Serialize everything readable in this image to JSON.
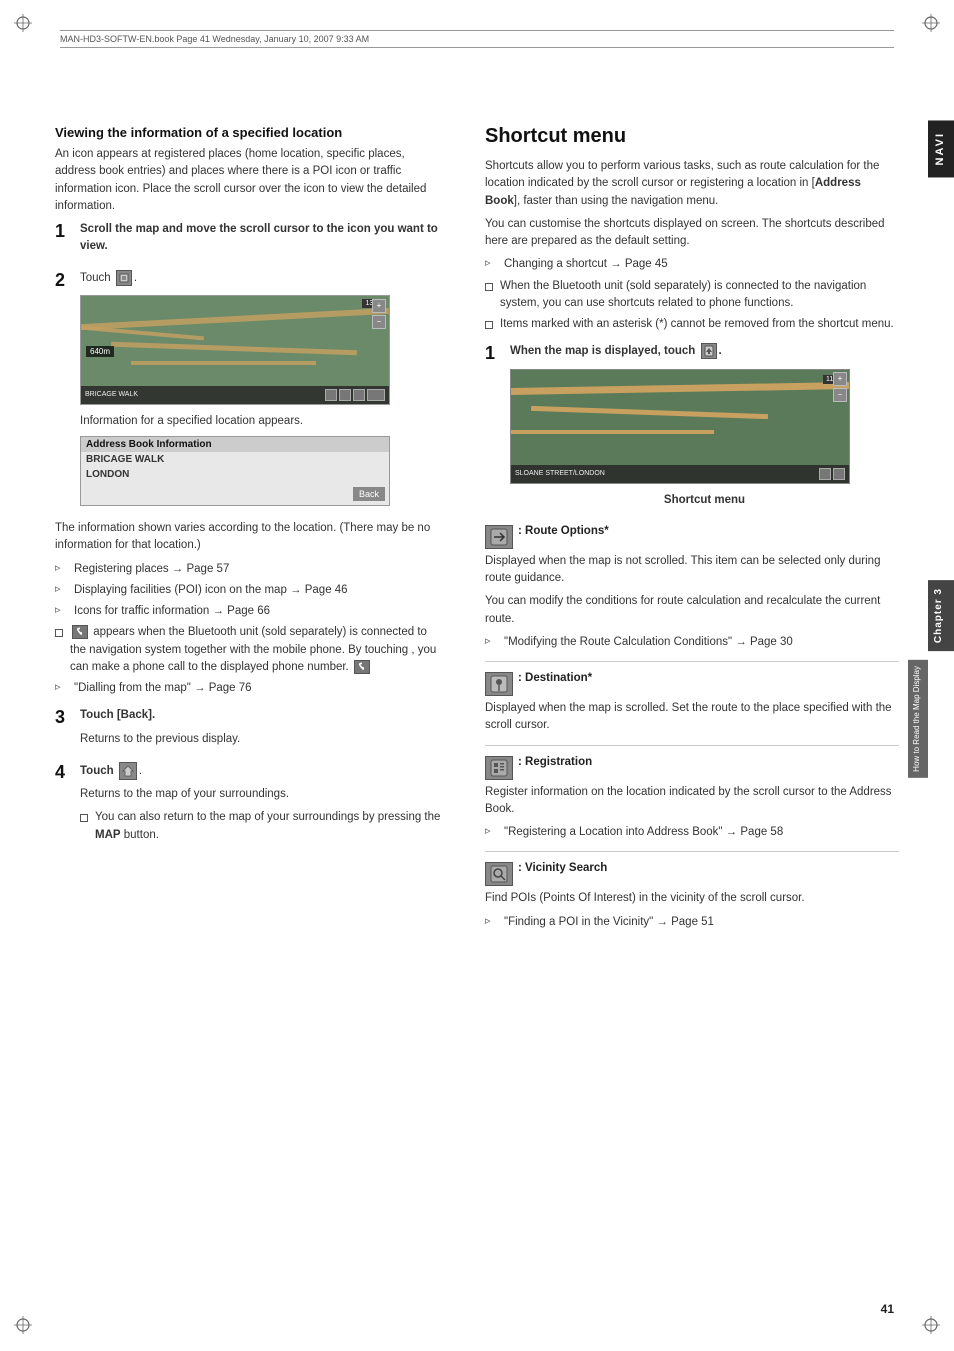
{
  "page": {
    "header": "MAN-HD3-SOFTW-EN.book  Page 41  Wednesday, January 10, 2007  9:33 AM",
    "page_number": "41",
    "navi_tab": "NAVI",
    "chapter_tab": "Chapter 3",
    "chapter_sub_tab": "How to Read the Map Display"
  },
  "left_section": {
    "heading": "Viewing the information of a specified location",
    "intro": "An icon appears at registered places (home location, specific places, address book entries) and places where there is a POI icon or traffic information icon. Place the scroll cursor over the icon to view the detailed information.",
    "step1": {
      "number": "1",
      "text": "Scroll the map and move the scroll cursor to the icon you want to view."
    },
    "step2": {
      "number": "2",
      "text": "Touch"
    },
    "map_caption": "Information for a specified location appears.",
    "map_info_title": "Address Book Information",
    "map_info_row1": "BRICAGE WALK",
    "map_info_row2": "LONDON",
    "info_body": "The information shown varies according to the location. (There may be no information for that location.)",
    "bullets": [
      {
        "type": "arrow",
        "text": "Registering places → Page 57"
      },
      {
        "type": "arrow",
        "text": "Displaying facilities (POI) icon on the map → Page 46"
      },
      {
        "type": "arrow",
        "text": "Icons for traffic information → Page 66"
      },
      {
        "type": "square",
        "text": "appears when the Bluetooth unit (sold separately) is connected to the navigation system together with the mobile phone. By touching , you can make a phone call to the displayed phone number."
      },
      {
        "type": "arrow",
        "text": "\"Dialling from the map\" → Page 76"
      }
    ],
    "step3": {
      "number": "3",
      "label": "Touch [Back].",
      "text": "Returns to the previous display."
    },
    "step4": {
      "number": "4",
      "label": "Touch",
      "text": "Returns to the map of your surroundings.",
      "sub_bullet": "You can also return to the map of your surroundings by pressing the MAP button."
    }
  },
  "right_section": {
    "title": "Shortcut menu",
    "intro1": "Shortcuts allow you to perform various tasks, such as route calculation for the location indicated by the scroll cursor or registering a location in [Address Book], faster than using the navigation menu.",
    "intro2": "You can customise the shortcuts displayed on screen. The shortcuts described here are prepared as the default setting.",
    "bullets": [
      {
        "type": "arrow",
        "text": "Changing a shortcut → Page 45"
      },
      {
        "type": "square",
        "text": "When the Bluetooth unit (sold separately) is connected to the navigation system, you can use shortcuts related to phone functions."
      },
      {
        "type": "square",
        "text": "Items marked with an asterisk (*) cannot be removed from the shortcut menu."
      }
    ],
    "step1": {
      "number": "1",
      "text": "When the map is displayed, touch"
    },
    "map_caption": "Shortcut menu",
    "icon_sections": [
      {
        "icon_label": ": Route Options*",
        "body": "Displayed when the map is not scrolled. This item can be selected only during route guidance.",
        "body2": "You can modify the conditions for route calculation and recalculate the current route.",
        "arrow_text": "\"Modifying the Route Calculation Conditions\" → Page 30"
      },
      {
        "icon_label": ": Destination*",
        "body": "Displayed when the map is scrolled. Set the route to the place specified with the scroll cursor."
      },
      {
        "icon_label": ": Registration",
        "body": "Register information on the location indicated by the scroll cursor to the Address Book.",
        "arrow_text": "\"Registering a Location into Address Book\" → Page 58"
      },
      {
        "icon_label": ": Vicinity Search",
        "body": "Find POIs (Points Of Interest) in the vicinity of the scroll cursor.",
        "arrow_text": "\"Finding a POI in the Vicinity\" → Page 51"
      }
    ]
  }
}
